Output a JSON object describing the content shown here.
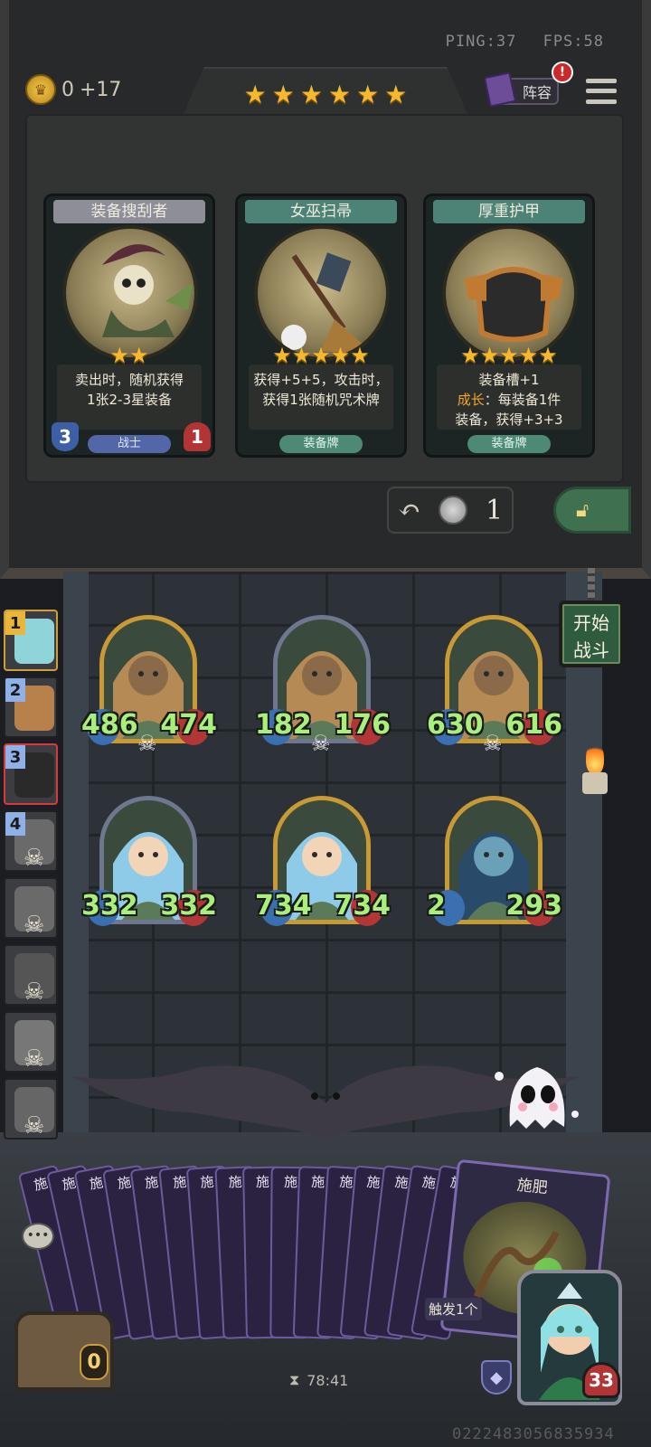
{
  "status": {
    "ping": "PING:37",
    "fps": "FPS:58"
  },
  "gold": {
    "amount": "0",
    "income": "+17",
    "coin_icon": "crown-coin-icon"
  },
  "shop": {
    "tier_stars": 6,
    "lineup_label": "阵容",
    "alert_badge": "!",
    "cards": [
      {
        "name": "装备搜刮者",
        "stars": 2,
        "desc_line1": "卖出时，随机获得",
        "desc_line2": "1张2-3星装备",
        "tag": "战士",
        "attack": "3",
        "health": "1",
        "style": "grey"
      },
      {
        "name": "女巫扫帚",
        "stars": 5,
        "desc_line1": "获得+5+5，攻击时，",
        "desc_line2": "获得1张随机咒术牌",
        "tag": "装备牌",
        "style": "green"
      },
      {
        "name": "厚重护甲",
        "stars": 5,
        "desc_line1": "装备槽+1",
        "growth_label": "成长",
        "growth_text": "：每装备1件",
        "desc_line3": "装备，获得+3+3",
        "tag": "装备牌",
        "style": "green"
      }
    ],
    "refresh_cost": "1",
    "lock_icon": "padlock-icon"
  },
  "queue": [
    {
      "num": "1",
      "state": "current"
    },
    {
      "num": "2",
      "state": "alive"
    },
    {
      "num": "3",
      "state": "active"
    },
    {
      "num": "4",
      "state": "dead"
    },
    {
      "num": "",
      "state": "dead"
    },
    {
      "num": "",
      "state": "dead"
    },
    {
      "num": "",
      "state": "dead"
    },
    {
      "num": "",
      "state": "dead"
    }
  ],
  "start_button": {
    "line1": "开始",
    "line2": "战斗"
  },
  "board": {
    "back_row": [
      {
        "atk": "486",
        "hp": "474",
        "frame": "gold"
      },
      {
        "atk": "182",
        "hp": "176",
        "frame": "silver"
      },
      {
        "atk": "630",
        "hp": "616",
        "frame": "gold"
      }
    ],
    "front_row": [
      {
        "atk": "332",
        "hp": "332",
        "frame": "silver"
      },
      {
        "atk": "734",
        "hp": "734",
        "frame": "gold"
      },
      {
        "atk": "2",
        "hp": "293",
        "frame": "gold"
      }
    ]
  },
  "hand": {
    "small_card_label": "施",
    "small_card_count": 16,
    "featured_card": {
      "title": "施肥",
      "trigger": "触发1个"
    }
  },
  "chest_count": "0",
  "timer": "78:41",
  "hero": {
    "hp": "33"
  },
  "user_id": "0222483056835934"
}
